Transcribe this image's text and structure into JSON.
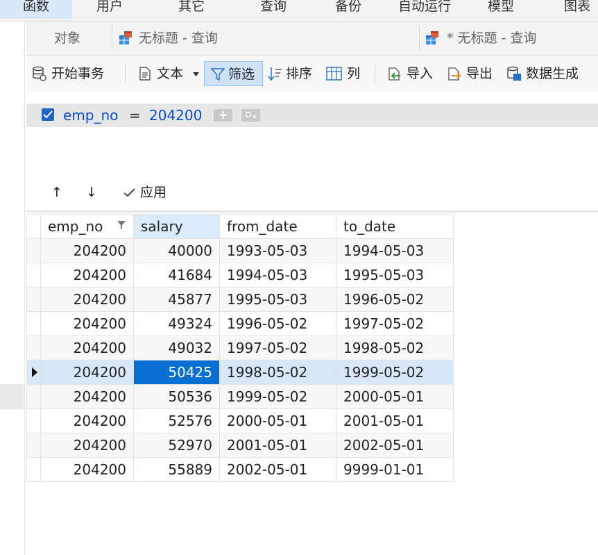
{
  "menu": {
    "items": [
      "函数",
      "用户",
      "其它",
      "查询",
      "备份",
      "自动运行",
      "模型",
      "图表"
    ],
    "active_index": 0
  },
  "tabs": {
    "objects": "对象",
    "tab1": "无标题 - 查询",
    "tab2": "* 无标题 - 查询"
  },
  "toolbar": {
    "begin_transaction": "开始事务",
    "text": "文本",
    "filter": "筛选",
    "sort": "排序",
    "columns": "列",
    "import": "导入",
    "export": "导出",
    "data_generation": "数据生成"
  },
  "filter": {
    "checked": true,
    "field": "emp_no",
    "operator": "=",
    "value": "204200",
    "add_label": "+",
    "accent": "#0b4dd1"
  },
  "actions": {
    "move_up": "↑",
    "move_down": "↓",
    "apply": "应用"
  },
  "grid": {
    "columns": [
      "emp_no",
      "salary",
      "from_date",
      "to_date"
    ],
    "filtered_column": "emp_no",
    "sorted_column": "salary",
    "rows": [
      [
        "204200",
        "40000",
        "1993-05-03",
        "1994-05-03"
      ],
      [
        "204200",
        "41684",
        "1994-05-03",
        "1995-05-03"
      ],
      [
        "204200",
        "45877",
        "1995-05-03",
        "1996-05-02"
      ],
      [
        "204200",
        "49324",
        "1996-05-02",
        "1997-05-02"
      ],
      [
        "204200",
        "49032",
        "1997-05-02",
        "1998-05-02"
      ],
      [
        "204200",
        "50425",
        "1998-05-02",
        "1999-05-02"
      ],
      [
        "204200",
        "50536",
        "1999-05-02",
        "2000-05-01"
      ],
      [
        "204200",
        "52576",
        "2000-05-01",
        "2001-05-01"
      ],
      [
        "204200",
        "52970",
        "2001-05-01",
        "2002-05-01"
      ],
      [
        "204200",
        "55889",
        "2002-05-01",
        "9999-01-01"
      ]
    ],
    "current_row": 5,
    "selected_cell_column": 1,
    "selection_color": "#0a6fd3"
  }
}
